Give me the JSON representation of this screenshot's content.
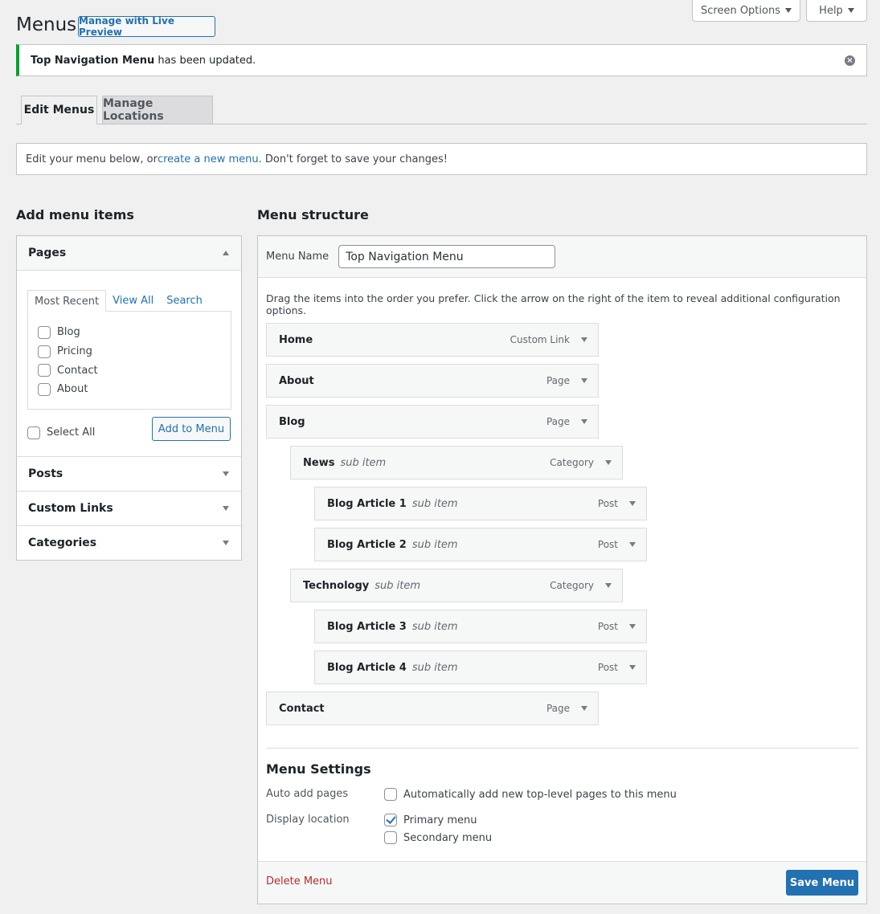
{
  "screen_meta": {
    "screen_options_label": "Screen Options",
    "help_label": "Help"
  },
  "header": {
    "title": "Menus",
    "live_preview_label": "Manage with Live Preview"
  },
  "notice": {
    "menu_name": "Top Navigation Menu",
    "message": " has been updated.",
    "dismiss_icon": "×"
  },
  "tabs": [
    {
      "label": "Edit Menus",
      "active": true
    },
    {
      "label": "Manage Locations",
      "active": false
    }
  ],
  "manage_box": {
    "text_before": "Edit your menu below, or ",
    "link_text": "create a new menu",
    "text_after": ". Don't forget to save your changes!"
  },
  "add_items": {
    "heading": "Add menu items",
    "sections": [
      {
        "label": "Pages",
        "expanded": true
      },
      {
        "label": "Posts",
        "expanded": false
      },
      {
        "label": "Custom Links",
        "expanded": false
      },
      {
        "label": "Categories",
        "expanded": false
      }
    ],
    "pages": {
      "tabs": [
        "Most Recent",
        "View All",
        "Search"
      ],
      "items": [
        {
          "label": "Blog",
          "checked": false
        },
        {
          "label": "Pricing",
          "checked": false
        },
        {
          "label": "Contact",
          "checked": false
        },
        {
          "label": "About",
          "checked": false
        }
      ],
      "select_all_label": "Select All",
      "add_button_label": "Add to Menu"
    }
  },
  "structure": {
    "heading": "Menu structure",
    "menu_name_label": "Menu Name",
    "menu_name_value": "Top Navigation Menu",
    "drag_hint": "Drag the items into the order you prefer. Click the arrow on the right of the item to reveal additional configuration options.",
    "items": [
      {
        "title": "Home",
        "sub": "",
        "type": "Custom Link",
        "depth": 0
      },
      {
        "title": "About",
        "sub": "",
        "type": "Page",
        "depth": 0
      },
      {
        "title": "Blog",
        "sub": "",
        "type": "Page",
        "depth": 0
      },
      {
        "title": "News",
        "sub": "sub item",
        "type": "Category",
        "depth": 1
      },
      {
        "title": "Blog Article 1",
        "sub": "sub item",
        "type": "Post",
        "depth": 2
      },
      {
        "title": "Blog Article 2",
        "sub": "sub item",
        "type": "Post",
        "depth": 2
      },
      {
        "title": "Technology",
        "sub": "sub item",
        "type": "Category",
        "depth": 1
      },
      {
        "title": "Blog Article 3",
        "sub": "sub item",
        "type": "Post",
        "depth": 2
      },
      {
        "title": "Blog Article 4",
        "sub": "sub item",
        "type": "Post",
        "depth": 2
      },
      {
        "title": "Contact",
        "sub": "",
        "type": "Page",
        "depth": 0
      }
    ]
  },
  "settings": {
    "heading": "Menu Settings",
    "auto_add_label": "Auto add pages",
    "auto_add_option": {
      "label": "Automatically add new top-level pages to this menu",
      "checked": false
    },
    "display_location_label": "Display location",
    "locations": [
      {
        "label": "Primary menu",
        "checked": true
      },
      {
        "label": "Secondary menu",
        "checked": false
      }
    ]
  },
  "footer": {
    "delete_label": "Delete Menu",
    "save_label": "Save Menu"
  }
}
